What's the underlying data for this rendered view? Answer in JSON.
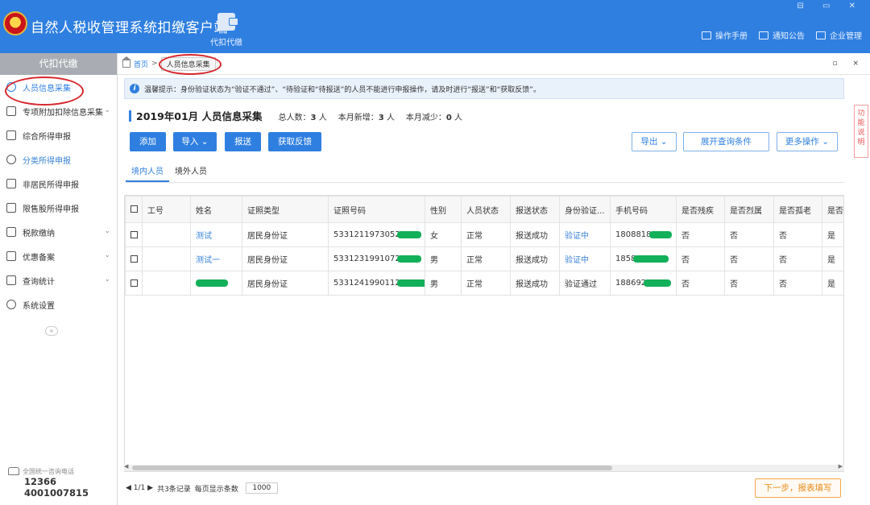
{
  "header": {
    "app_title": "自然人税收管理系统扣缴客户端",
    "module_label": "代扣代缴",
    "window_controls": "⊟ ▭ ✕",
    "links": [
      {
        "label": "操作手册",
        "icon": "book-icon"
      },
      {
        "label": "通知公告",
        "icon": "mail-icon"
      },
      {
        "label": "企业管理",
        "icon": "building-icon"
      }
    ]
  },
  "sidebar": {
    "title": "代扣代缴",
    "items": [
      {
        "label": "人员信息采集",
        "icon": "user-icon"
      },
      {
        "label": "专项附加扣除信息采集",
        "icon": "list-icon"
      },
      {
        "label": "综合所得申报",
        "icon": "layers-icon"
      },
      {
        "label": "分类所得申报",
        "icon": "pie-icon"
      },
      {
        "label": "非居民所得申报",
        "icon": "person-icon"
      },
      {
        "label": "限售股所得申报",
        "icon": "bar-chart-icon"
      },
      {
        "label": "税款缴纳",
        "icon": "wallet-icon"
      },
      {
        "label": "优惠备案",
        "icon": "document-icon"
      },
      {
        "label": "查询统计",
        "icon": "query-icon"
      },
      {
        "label": "系统设置",
        "icon": "gear-icon"
      }
    ],
    "collapse": "«",
    "hotline_label": "全国统一咨询电话",
    "hotline_numbers": [
      "12366",
      "4001007815"
    ]
  },
  "breadcrumb": {
    "home": "首页",
    "sep": ">",
    "current": "人员信息采集",
    "controls": "▫ ×"
  },
  "tip": {
    "icon": "i",
    "text": "温馨提示：身份验证状态为“验证不通过”、“待验证和“待报送”的人员不能进行申报操作，请及时进行“报送”和“获取反馈”。"
  },
  "summary": {
    "title": "2019年01月  人员信息采集",
    "total_label": "总人数：",
    "total": "3",
    "total_unit": " 人",
    "added_label": "本月新增：",
    "added": "3",
    "added_unit": " 人",
    "reduced_label": "本月减少：",
    "reduced": "0",
    "reduced_unit": " 人"
  },
  "buttons": {
    "add": "添加",
    "import": "导入",
    "submit": "报送",
    "feedback": "获取反馈",
    "export": "导出",
    "expand_query": "展开查询条件",
    "more_ops": "更多操作"
  },
  "subtabs": [
    "境内人员",
    "境外人员"
  ],
  "side_help": "功能说明",
  "table": {
    "headers": [
      "工号",
      "姓名",
      "证照类型",
      "证照号码",
      "性别",
      "人员状态",
      "报送状态",
      "身份验证...",
      "手机号码",
      "是否残疾",
      "是否烈属",
      "是否孤老",
      "是否"
    ],
    "rows": [
      {
        "id": "",
        "name": "测试",
        "id_type": "居民身份证",
        "id_no": "5331211973052",
        "gender": "女",
        "status": "正常",
        "submit": "报送成功",
        "verify": "验证中",
        "phone": "1808818",
        "disabled": "否",
        "martyr": "否",
        "lonely": "否",
        "last": "是"
      },
      {
        "id": "",
        "name": "测试一",
        "id_type": "居民身份证",
        "id_no": "5331231991072",
        "gender": "男",
        "status": "正常",
        "submit": "报送成功",
        "verify": "验证中",
        "phone": "1858",
        "disabled": "否",
        "martyr": "否",
        "lonely": "否",
        "last": "是"
      },
      {
        "id": "",
        "name": "",
        "id_type": "居民身份证",
        "id_no": "5331241990112",
        "gender": "男",
        "status": "正常",
        "submit": "报送成功",
        "verify": "验证通过",
        "phone": "188692",
        "disabled": "否",
        "martyr": "否",
        "lonely": "否",
        "last": "是"
      }
    ]
  },
  "pager": {
    "nav": "◀ 1/1 ▶",
    "records": "共3条记录",
    "per_page_label": "每页显示条数",
    "per_page": "1000"
  },
  "next_button": "下一步，报表填写",
  "colors": {
    "primary": "#2f7fe0",
    "annotation": "#d7262b",
    "redaction": "#13b05a",
    "next": "#e88b1a"
  }
}
